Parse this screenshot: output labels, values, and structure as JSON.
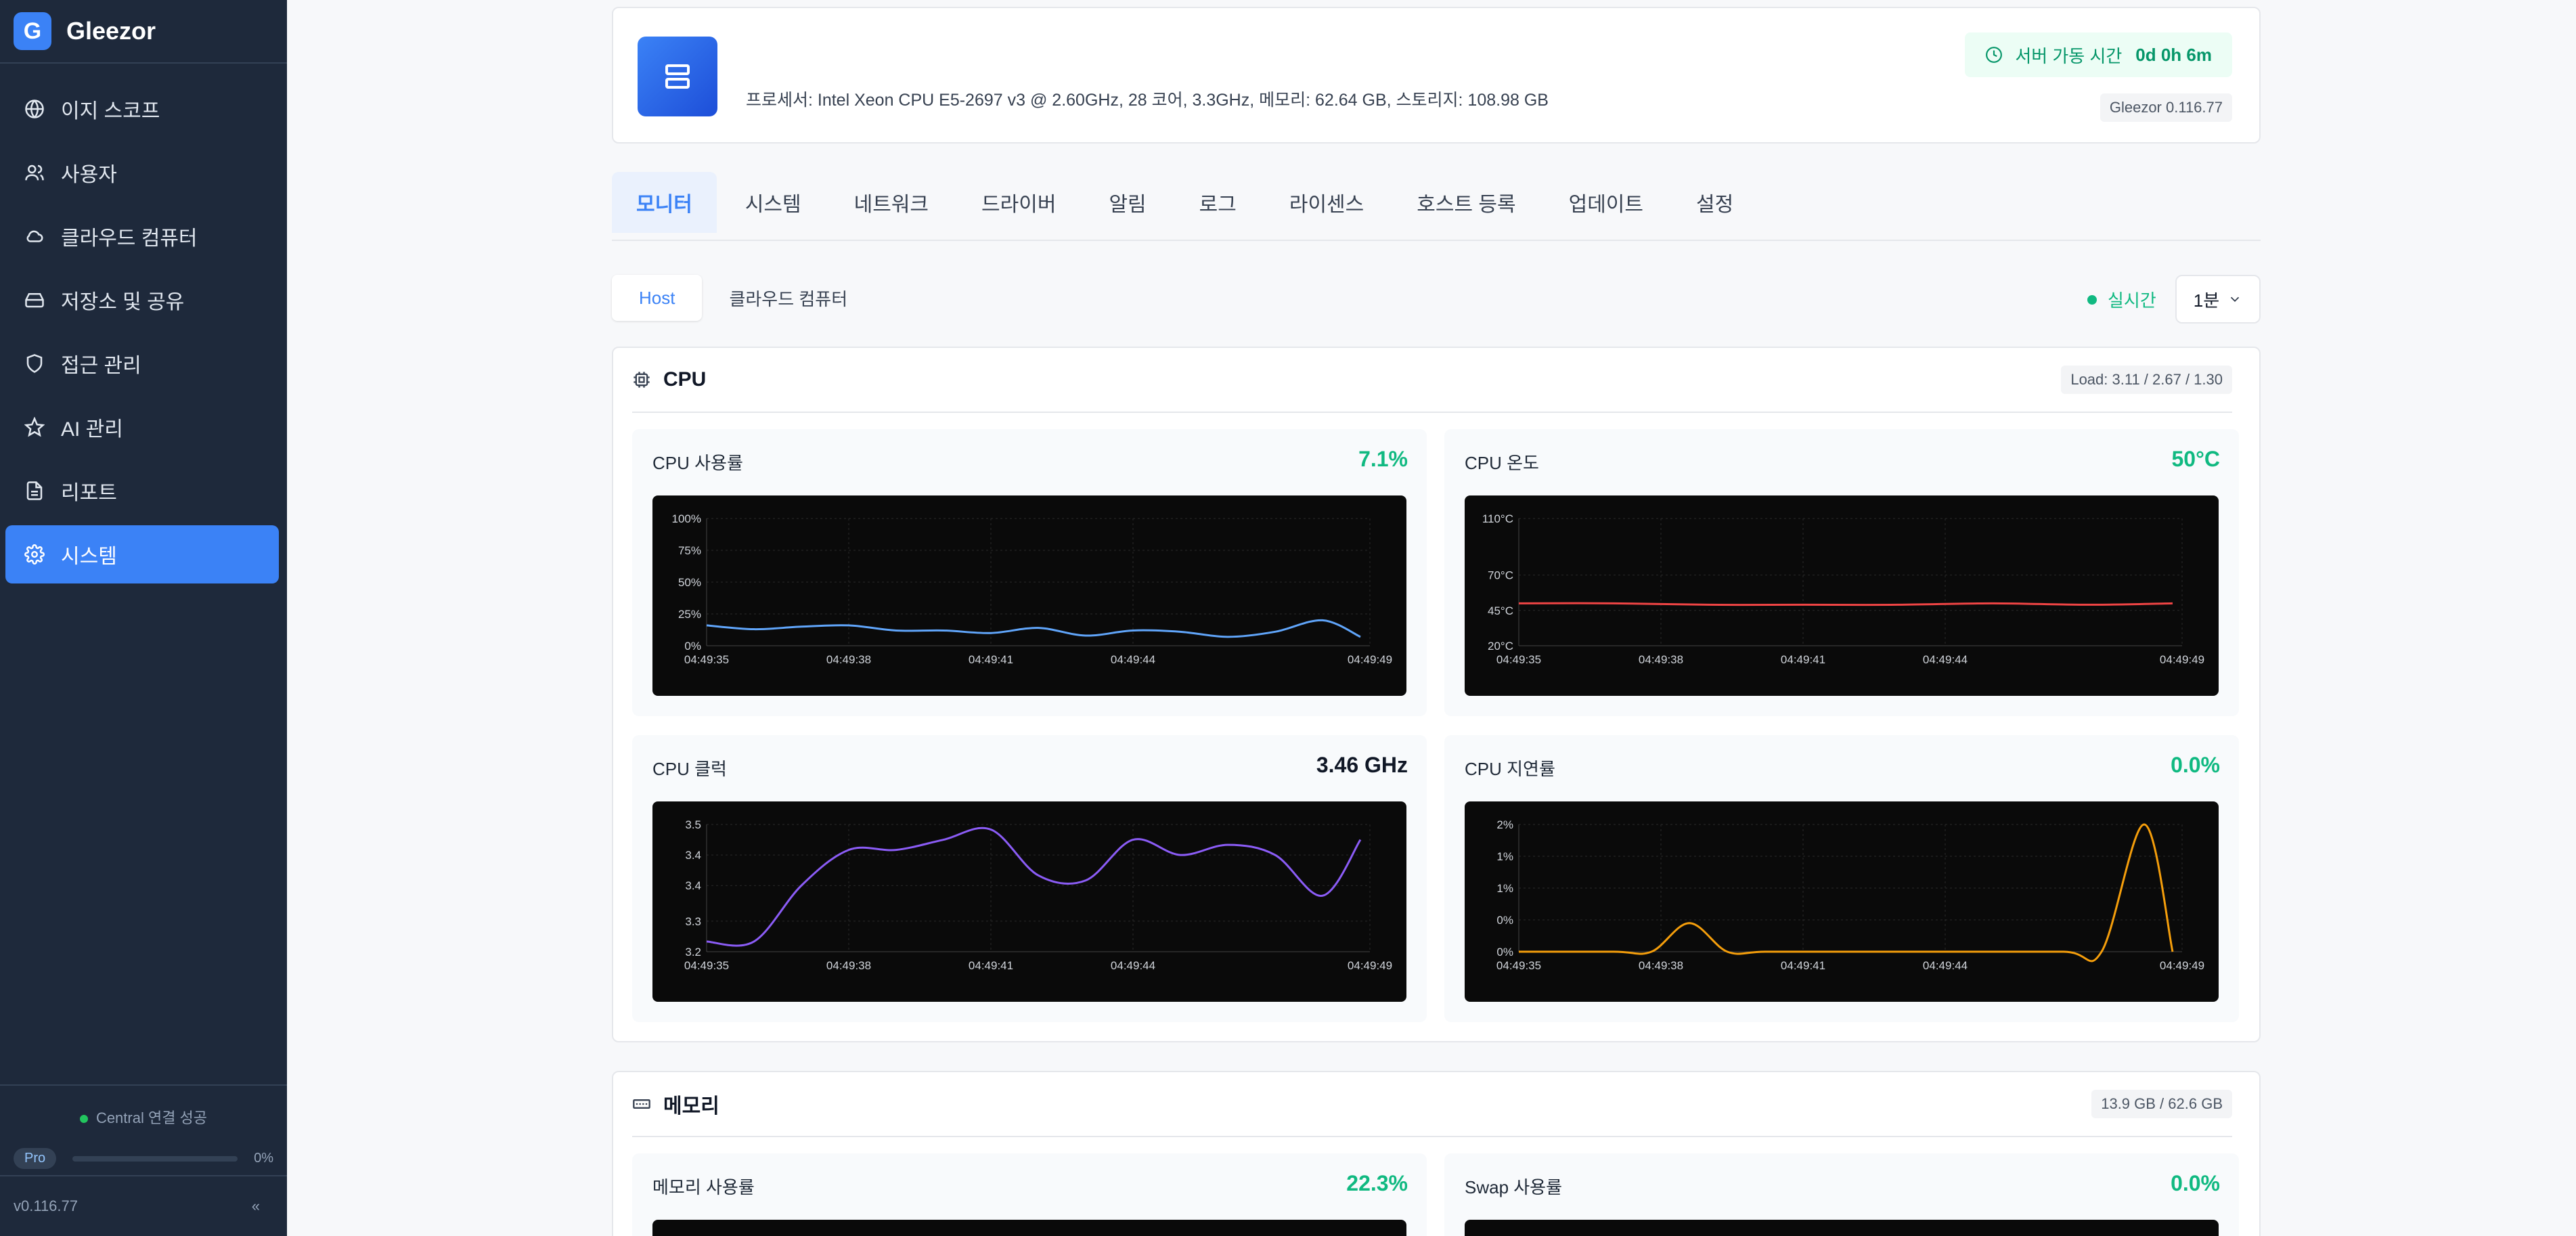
{
  "brand": {
    "logo_letter": "G",
    "name": "Gleezor"
  },
  "sidebar": {
    "items": [
      {
        "label": "이지 스코프",
        "icon": "globe-icon"
      },
      {
        "label": "사용자",
        "icon": "users-icon"
      },
      {
        "label": "클라우드 컴퓨터",
        "icon": "cloud-icon"
      },
      {
        "label": "저장소 및 공유",
        "icon": "hard-drive-icon"
      },
      {
        "label": "접근 관리",
        "icon": "shield-icon"
      },
      {
        "label": "AI 관리",
        "icon": "star-icon"
      },
      {
        "label": "리포트",
        "icon": "file-text-icon"
      },
      {
        "label": "시스템",
        "icon": "gear-icon",
        "active": true
      }
    ],
    "central_status": "Central 연결 성공",
    "plan": {
      "badge": "Pro",
      "progress_percent": 0,
      "progress_label": "0%"
    },
    "version": "v0.116.77",
    "collapse_symbol": "«"
  },
  "host": {
    "spec": "프로세서: Intel Xeon CPU E5-2697 v3 @ 2.60GHz, 28 코어, 3.3GHz, 메모리: 62.64 GB, 스토리지: 108.98 GB",
    "uptime_label": "서버 가동 시간",
    "uptime_value": "0d 0h 6m",
    "app_version": "Gleezor 0.116.77"
  },
  "tabs": [
    "모니터",
    "시스템",
    "네트워크",
    "드라이버",
    "알림",
    "로그",
    "라이센스",
    "호스트 등록",
    "업데이트",
    "설정"
  ],
  "subtabs": [
    "Host",
    "클라우드 컴퓨터"
  ],
  "realtime_label": "실시간",
  "interval": {
    "selected": "1분"
  },
  "cpu_section": {
    "title": "CPU",
    "load": "Load: 3.11 / 2.67 / 1.30",
    "panels": {
      "usage": {
        "title": "CPU 사용률",
        "value": "7.1%"
      },
      "temp": {
        "title": "CPU 온도",
        "value": "50°C"
      },
      "clock": {
        "title": "CPU 클럭",
        "value": "3.46 GHz"
      },
      "latency": {
        "title": "CPU 지연률",
        "value": "0.0%"
      }
    }
  },
  "memory_section": {
    "title": "메모리",
    "badge": "13.9 GB / 62.6 GB",
    "panels": {
      "mem": {
        "title": "메모리 사용률",
        "value": "22.3%"
      },
      "swap": {
        "title": "Swap 사용률",
        "value": "0.0%"
      }
    }
  },
  "chart_data": [
    {
      "type": "line",
      "title": "CPU 사용률",
      "color": "#60a5fa",
      "yticks": [
        "100%",
        "75%",
        "50%",
        "25%",
        "0%"
      ],
      "ytick_values": [
        100,
        75,
        50,
        25,
        0
      ],
      "ylim": [
        0,
        100
      ],
      "xticks": [
        "04:49:35",
        "04:49:38",
        "04:49:41",
        "04:49:44",
        "04:49:49"
      ],
      "xtick_values": [
        35,
        38,
        41,
        44,
        49
      ],
      "xlim": [
        35,
        49
      ],
      "x": [
        35,
        36,
        37,
        38,
        39,
        40,
        41,
        42,
        43,
        44,
        45,
        46,
        47,
        48,
        48.8
      ],
      "values": [
        16,
        13,
        15,
        16,
        12,
        12,
        10,
        14,
        8,
        12,
        11,
        7,
        11,
        20,
        7
      ]
    },
    {
      "type": "line",
      "title": "CPU 온도",
      "color": "#ef4444",
      "yticks": [
        "110°C",
        "70°C",
        "45°C",
        "20°C"
      ],
      "ytick_values": [
        110,
        70,
        45,
        20
      ],
      "ylim": [
        20,
        110
      ],
      "xticks": [
        "04:49:35",
        "04:49:38",
        "04:49:41",
        "04:49:44",
        "04:49:49"
      ],
      "xtick_values": [
        35,
        38,
        41,
        44,
        49
      ],
      "xlim": [
        35,
        49
      ],
      "x": [
        35,
        37,
        39,
        41,
        43,
        45,
        47,
        48.8
      ],
      "values": [
        50,
        50,
        49,
        49,
        49,
        50,
        49,
        50
      ]
    },
    {
      "type": "line",
      "title": "CPU 클럭",
      "color": "#8b5cf6",
      "yticks": [
        "3.5",
        "3.4",
        "3.4",
        "3.3",
        "3.2"
      ],
      "ytick_values": [
        3.49,
        3.43,
        3.37,
        3.3,
        3.24
      ],
      "ylim": [
        3.24,
        3.49
      ],
      "xticks": [
        "04:49:35",
        "04:49:38",
        "04:49:41",
        "04:49:44",
        "04:49:49"
      ],
      "xtick_values": [
        35,
        38,
        41,
        44,
        49
      ],
      "xlim": [
        35,
        49
      ],
      "x": [
        35,
        36,
        37,
        38,
        39,
        40,
        41,
        42,
        43,
        44,
        45,
        46,
        47,
        48,
        48.8
      ],
      "values": [
        3.26,
        3.26,
        3.37,
        3.44,
        3.44,
        3.46,
        3.48,
        3.39,
        3.38,
        3.46,
        3.43,
        3.45,
        3.43,
        3.35,
        3.46
      ]
    },
    {
      "type": "line",
      "title": "CPU 지연률",
      "color": "#f59e0b",
      "yticks": [
        "2%",
        "1%",
        "1%",
        "0%",
        "0%"
      ],
      "ytick_values": [
        2.0,
        1.5,
        1.0,
        0.5,
        0
      ],
      "ylim": [
        0,
        2.0
      ],
      "xticks": [
        "04:49:35",
        "04:49:38",
        "04:49:41",
        "04:49:44",
        "04:49:49"
      ],
      "xtick_values": [
        35,
        38,
        41,
        44,
        49
      ],
      "xlim": [
        35,
        49
      ],
      "x": [
        35,
        37,
        37.8,
        38.6,
        39.4,
        40.2,
        42,
        44,
        46.5,
        47.3,
        48.2,
        48.8
      ],
      "values": [
        0,
        0,
        0,
        0.45,
        0,
        0,
        0,
        0,
        0,
        0,
        2.0,
        0
      ]
    }
  ]
}
